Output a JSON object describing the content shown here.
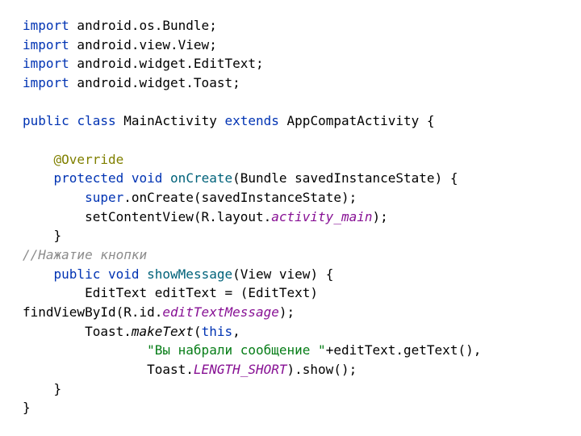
{
  "code": {
    "l1_kw": "import",
    "l1_rest": " android.os.Bundle;",
    "l2_kw": "import",
    "l2_rest": " android.view.View;",
    "l3_kw": "import",
    "l3_rest": " android.widget.EditText;",
    "l4_kw": "import",
    "l4_rest": " android.widget.Toast;",
    "l6_kw1": "public",
    "l6_sp1": " ",
    "l6_kw2": "class",
    "l6_mid": " MainActivity ",
    "l6_kw3": "extends",
    "l6_rest": " AppCompatActivity {",
    "l8_indent": "    ",
    "l8_ann": "@Override",
    "l9_indent": "    ",
    "l9_kw1": "protected",
    "l9_sp1": " ",
    "l9_kw2": "void",
    "l9_sp2": " ",
    "l9_method": "onCreate",
    "l9_rest": "(Bundle savedInstanceState) {",
    "l10_indent": "        ",
    "l10_kw": "super",
    "l10_rest": ".onCreate(savedInstanceState);",
    "l11_indent": "        ",
    "l11_a": "setContentView(R.layout.",
    "l11_field": "activity_main",
    "l11_b": ");",
    "l12_indent": "    ",
    "l12_brace": "}",
    "l13_comment": "//Нажатие кнопки",
    "l14_indent": "    ",
    "l14_kw1": "public",
    "l14_sp1": " ",
    "l14_kw2": "void",
    "l14_sp2": " ",
    "l14_method": "showMessage",
    "l14_rest": "(View view) {",
    "l15_indent": "        ",
    "l15_rest": "EditText editText = (EditText) ",
    "l16_a": "findViewById(R.id.",
    "l16_field": "editTextMessage",
    "l16_b": ");",
    "l17_indent": "        ",
    "l17_a": "Toast.",
    "l17_static": "makeText",
    "l17_b": "(",
    "l17_kw": "this",
    "l17_c": ",",
    "l18_indent": "                ",
    "l18_str": "\"Вы набрали сообщение \"",
    "l18_rest": "+editText.getText(),",
    "l19_indent": "                ",
    "l19_a": "Toast.",
    "l19_field": "LENGTH_SHORT",
    "l19_b": ").show();",
    "l20_indent": "    ",
    "l20_brace": "}",
    "l21_brace": "}"
  }
}
